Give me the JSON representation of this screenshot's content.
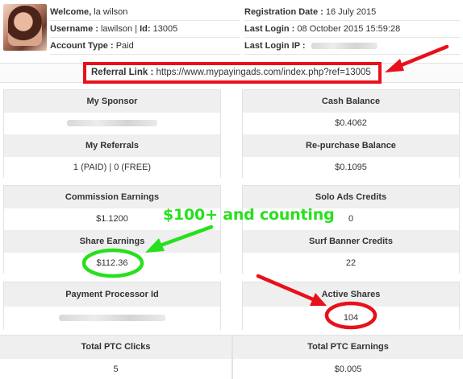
{
  "header": {
    "welcome_label": "Welcome,",
    "welcome_name": "la wilson",
    "username_label": "Username :",
    "username_value": "lawilson",
    "id_label": "Id:",
    "id_value": "13005",
    "account_type_label": "Account Type :",
    "account_type_value": "Paid",
    "registration_label": "Registration Date :",
    "registration_value": "16 July 2015",
    "last_login_label": "Last Login :",
    "last_login_value": "08 October 2015 15:59:28",
    "last_login_ip_label": "Last Login IP :"
  },
  "referral": {
    "label": "Referral Link :",
    "url": "https://www.mypayingads.com/index.php?ref=13005"
  },
  "stats": {
    "my_sponsor": {
      "label": "My Sponsor"
    },
    "cash_balance": {
      "label": "Cash Balance",
      "value": "$0.4062"
    },
    "my_referrals": {
      "label": "My Referrals",
      "value": "1 (PAID) | 0 (FREE)"
    },
    "repurchase_balance": {
      "label": "Re-purchase Balance",
      "value": "$0.1095"
    },
    "commission_earnings": {
      "label": "Commission Earnings",
      "value": "$1.1200"
    },
    "solo_ads_credits": {
      "label": "Solo Ads Credits",
      "value": "0"
    },
    "share_earnings": {
      "label": "Share Earnings",
      "value": "$112.36"
    },
    "surf_banner_credits": {
      "label": "Surf Banner Credits",
      "value": "22"
    },
    "payment_processor_id": {
      "label": "Payment Processor Id"
    },
    "active_shares": {
      "label": "Active Shares",
      "value": "104"
    },
    "total_ptc_clicks": {
      "label": "Total PTC Clicks",
      "value": "5"
    },
    "total_ptc_earnings": {
      "label": "Total PTC Earnings",
      "value": "$0.005"
    }
  },
  "annotation": {
    "caption": "$100+ and counting",
    "caption_color": "#27e01d",
    "highlight_red": "#e8111b"
  }
}
